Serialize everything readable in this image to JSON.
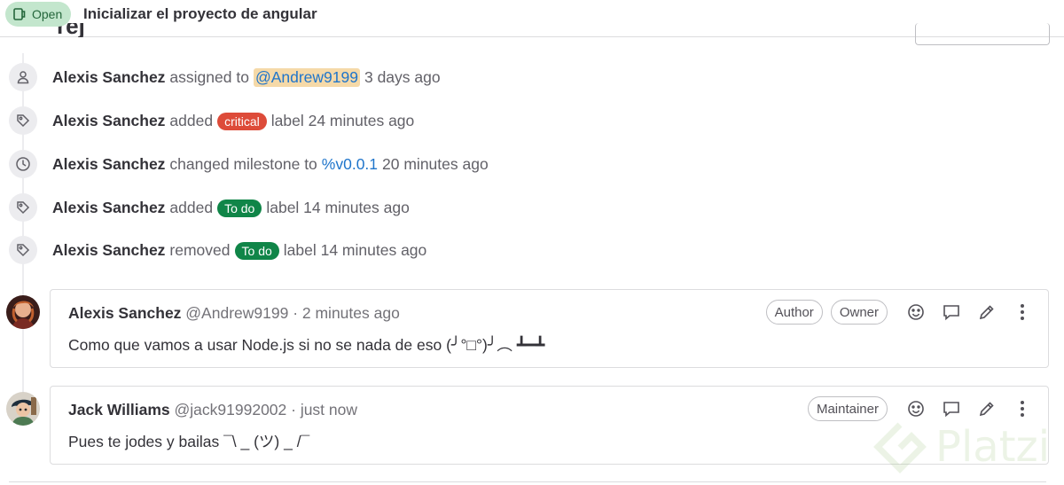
{
  "header": {
    "status": "Open",
    "title": "Inicializar el proyecto de angular"
  },
  "events": [
    {
      "icon": "user-icon",
      "author": "Alexis Sanchez",
      "action": "assigned to",
      "target": "@Andrew9199",
      "suffix": "3 days ago"
    },
    {
      "icon": "tag-icon",
      "author": "Alexis Sanchez",
      "action": "added",
      "label": "critical",
      "label_color": "#dd2b0e",
      "suffix": "label 24 minutes ago"
    },
    {
      "icon": "clock-icon",
      "author": "Alexis Sanchez",
      "action": "changed milestone to",
      "target": "%v0.0.1",
      "suffix": "20 minutes ago"
    },
    {
      "icon": "tag-icon",
      "author": "Alexis Sanchez",
      "action": "added",
      "label": "To do",
      "label_color": "#108548",
      "suffix": "label 14 minutes ago"
    },
    {
      "icon": "tag-icon",
      "author": "Alexis Sanchez",
      "action": "removed",
      "label": "To do",
      "label_color": "#108548",
      "suffix": "label 14 minutes ago"
    }
  ],
  "notes": [
    {
      "author": "Alexis Sanchez",
      "meta": "@Andrew9199 · 2 minutes ago",
      "badges": [
        "Author",
        "Owner"
      ],
      "body": "Como que vamos a usar Node.js si no se nada de eso (╯°□°)╯︵ ┻━┻"
    },
    {
      "author": "Jack Williams",
      "meta": "@jack91992002 · just now",
      "badges": [
        "Maintainer"
      ],
      "body": "Pues te jodes y bailas ¯\\ _ (ツ) _ /¯"
    }
  ],
  "watermark": "Platzi"
}
